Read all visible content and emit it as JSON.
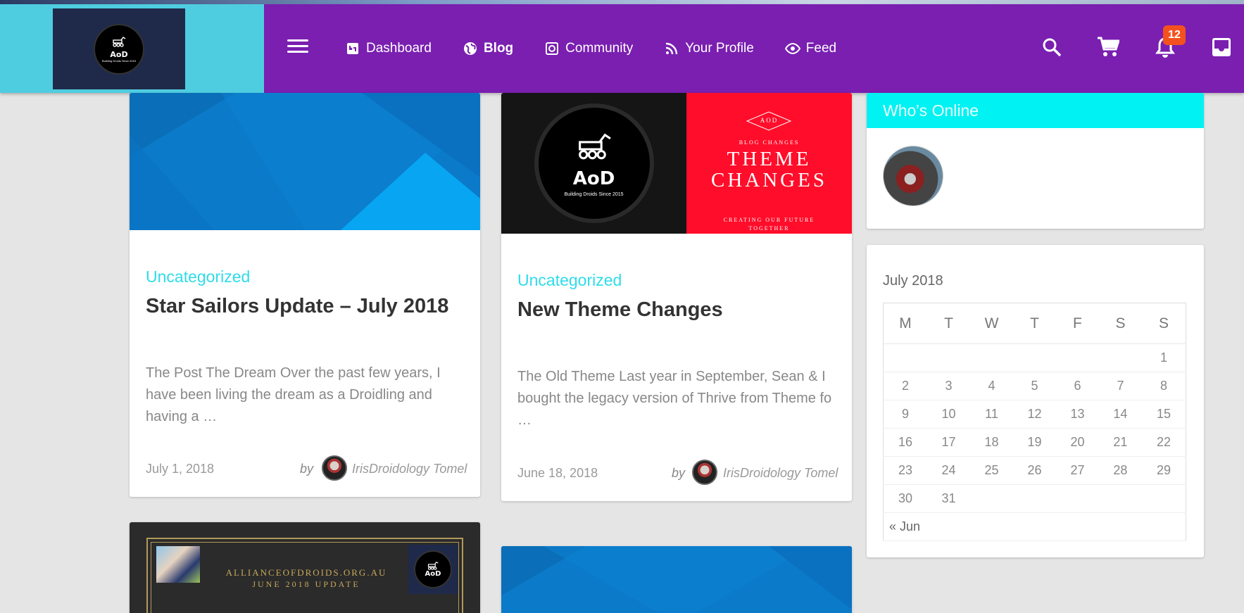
{
  "header": {
    "logo": {
      "text": "AoD",
      "subtext": "Building Droids Since 2015"
    },
    "nav": [
      {
        "label": "Dashboard",
        "icon": "dashboard-icon"
      },
      {
        "label": "Blog",
        "icon": "globe-icon"
      },
      {
        "label": "Community",
        "icon": "community-icon"
      },
      {
        "label": "Your Profile",
        "icon": "rss-icon"
      },
      {
        "label": "Feed",
        "icon": "eye-icon"
      }
    ],
    "notification_count": "12"
  },
  "posts": [
    {
      "category": "Uncategorized",
      "title": "Star Sailors Update – July 2018",
      "excerpt": "The Post The Dream Over the past few years, I have been living the dream as a Droidling and having a …",
      "date": "July 1, 2018",
      "by": "by",
      "author": "IrisDroidology Tomel"
    },
    {
      "category": "Uncategorized",
      "title": "New Theme Changes",
      "excerpt": "The Old Theme Last year in September, Sean & I bought the legacy version of Thrive from Theme fo …",
      "date": "June 18, 2018",
      "by": "by",
      "author": "IrisDroidology Tomel",
      "image": {
        "logo_text": "AoD",
        "logo_sub": "Building Droids Since 2015",
        "diamond_text": "AOD",
        "kicker": "BLOG CHANGES",
        "line1": "THEME",
        "line2": "CHANGES",
        "footer1": "CREATING OUR FUTURE",
        "footer2": "TOGETHER"
      }
    },
    {
      "image": {
        "site": "ALLIANCEOFDROIDS.ORG.AU",
        "subtitle": "JUNE 2018 UPDATE",
        "logo_text": "AoD"
      }
    }
  ],
  "sidebar": {
    "whos_online": {
      "title": "Who's Online"
    },
    "calendar": {
      "title": "July 2018",
      "days": [
        "M",
        "T",
        "W",
        "T",
        "F",
        "S",
        "S"
      ],
      "weeks": [
        [
          "",
          "",
          "",
          "",
          "",
          "",
          "1"
        ],
        [
          "2",
          "3",
          "4",
          "5",
          "6",
          "7",
          "8"
        ],
        [
          "9",
          "10",
          "11",
          "12",
          "13",
          "14",
          "15"
        ],
        [
          "16",
          "17",
          "18",
          "19",
          "20",
          "21",
          "22"
        ],
        [
          "23",
          "24",
          "25",
          "26",
          "27",
          "28",
          "29"
        ],
        [
          "30",
          "31",
          "",
          "",
          "",
          "",
          ""
        ]
      ],
      "prev_link": "« Jun"
    }
  },
  "colors": {
    "header": "#7a1fb0",
    "logo_panel": "#4fcde0",
    "category": "#2fdcea",
    "whos_online_header": "#00f2f2",
    "badge": "#f4511e"
  }
}
